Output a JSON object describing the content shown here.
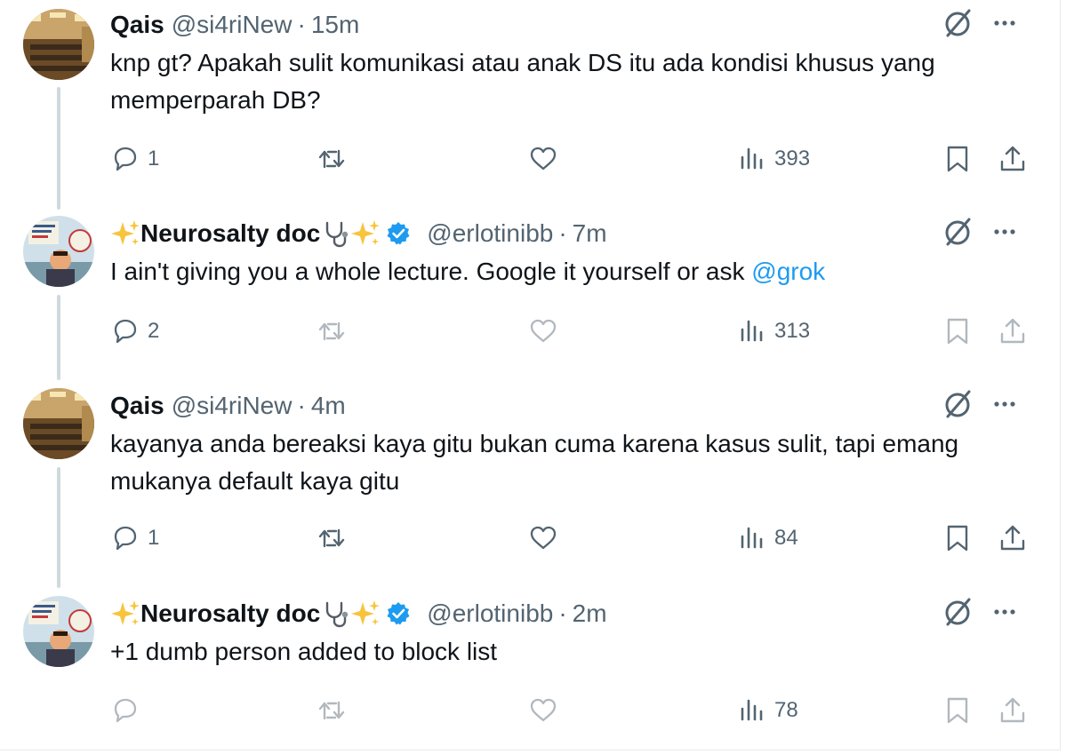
{
  "tweets": [
    {
      "name": "Qais",
      "handle": "@si4riNew",
      "separator": "·",
      "time": "15m",
      "text": "knp gt? Apakah sulit komunikasi atau anak DS itu ada kondisi khusus yang memperparah DB?",
      "mention": "",
      "replies": "1",
      "views": "393",
      "verified": false
    },
    {
      "name_prefix": "✨",
      "name": "Neurosalty doc",
      "name_suffix": "✨",
      "handle": "@erlotinibb",
      "separator": "·",
      "time": "7m",
      "text": "I ain't giving you a whole lecture. Google it yourself or ask ",
      "mention": "@grok",
      "replies": "2",
      "views": "313",
      "verified": true
    },
    {
      "name": "Qais",
      "handle": "@si4riNew",
      "separator": "·",
      "time": "4m",
      "text": "kayanya anda bereaksi kaya gitu bukan cuma karena kasus sulit, tapi emang mukanya default kaya gitu",
      "mention": "",
      "replies": "1",
      "views": "84",
      "verified": false
    },
    {
      "name_prefix": "✨",
      "name": "Neurosalty doc",
      "name_suffix": "✨",
      "handle": "@erlotinibb",
      "separator": "·",
      "time": "2m",
      "text": "+1 dumb person added to block list",
      "mention": "",
      "replies": "",
      "views": "78",
      "verified": true
    }
  ],
  "colors": {
    "text": "#0f1419",
    "muted": "#536471",
    "link": "#1d9bf0",
    "verified": "#1d9bf0",
    "thread_line": "#cfd9de"
  },
  "icons": [
    "reply-icon",
    "retweet-icon",
    "like-icon",
    "views-icon",
    "bookmark-icon",
    "share-icon",
    "grok-icon",
    "more-icon",
    "verified-badge-icon",
    "sparkle-emoji",
    "stethoscope-emoji"
  ]
}
